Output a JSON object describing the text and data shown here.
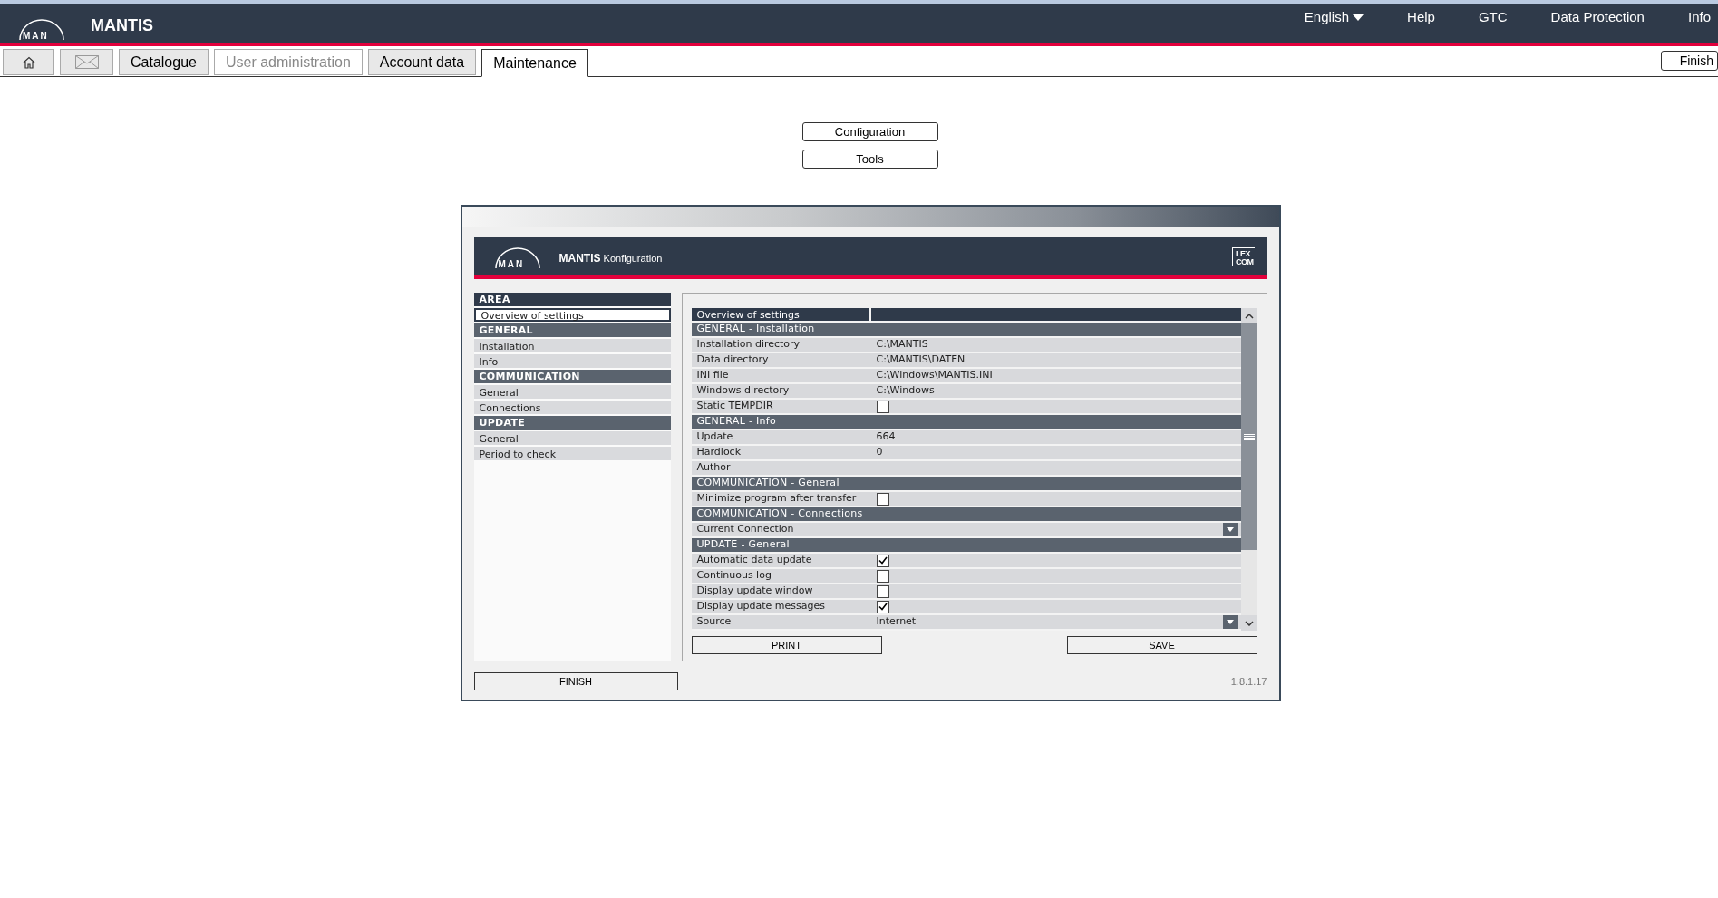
{
  "header": {
    "logo_text": "MAN",
    "title": "MANTIS",
    "menu": [
      {
        "label": "English",
        "dropdown": true
      },
      {
        "label": "Help",
        "dropdown": false
      },
      {
        "label": "GTC",
        "dropdown": false
      },
      {
        "label": "Data Protection",
        "dropdown": false
      },
      {
        "label": "Info",
        "dropdown": false
      }
    ]
  },
  "tabs": [
    {
      "kind": "home",
      "selected": false,
      "disabled": false
    },
    {
      "kind": "mail",
      "selected": false,
      "disabled": false
    },
    {
      "kind": "text",
      "label": "Catalogue",
      "selected": false,
      "disabled": false
    },
    {
      "kind": "text",
      "label": "User administration",
      "selected": false,
      "disabled": true
    },
    {
      "kind": "text",
      "label": "Account data",
      "selected": false,
      "disabled": false
    },
    {
      "kind": "text",
      "label": "Maintenance",
      "selected": true,
      "disabled": false
    }
  ],
  "finish_top": "Finish",
  "maintenance_buttons": [
    "Configuration",
    "Tools"
  ],
  "dialog": {
    "logo_text": "MAN",
    "app_name": "MANTIS",
    "title": "Konfiguration",
    "brand_logo": [
      "LEX",
      "COM"
    ],
    "sidebar": [
      {
        "kind": "header",
        "label": "AREA"
      },
      {
        "kind": "item",
        "label": "Overview of settings",
        "selected": true
      },
      {
        "kind": "header",
        "label": "GENERAL"
      },
      {
        "kind": "item",
        "label": "Installation",
        "selected": false
      },
      {
        "kind": "item",
        "label": "Info",
        "selected": false
      },
      {
        "kind": "header",
        "label": "COMMUNICATION"
      },
      {
        "kind": "item",
        "label": "General",
        "selected": false
      },
      {
        "kind": "item",
        "label": "Connections",
        "selected": false
      },
      {
        "kind": "header",
        "label": "UPDATE"
      },
      {
        "kind": "item",
        "label": "General",
        "selected": false
      },
      {
        "kind": "item",
        "label": "Period to check",
        "selected": false
      }
    ],
    "table_title": "Overview of settings",
    "rows": [
      {
        "kind": "section",
        "label": "GENERAL - Installation"
      },
      {
        "kind": "text",
        "label": "Installation directory",
        "value": "C:\\MANTIS"
      },
      {
        "kind": "text",
        "label": "Data directory",
        "value": "C:\\MANTIS\\DATEN"
      },
      {
        "kind": "text",
        "label": "INI file",
        "value": "C:\\Windows\\MANTIS.INI"
      },
      {
        "kind": "text",
        "label": "Windows directory",
        "value": "C:\\Windows"
      },
      {
        "kind": "checkbox",
        "label": "Static TEMPDIR",
        "checked": false
      },
      {
        "kind": "section",
        "label": "GENERAL - Info"
      },
      {
        "kind": "text",
        "label": "Update",
        "value": "664"
      },
      {
        "kind": "text",
        "label": "Hardlock",
        "value": "0"
      },
      {
        "kind": "text",
        "label": "Author"
      },
      {
        "kind": "section",
        "label": "COMMUNICATION - General"
      },
      {
        "kind": "checkbox",
        "label": "Minimize program after transfer",
        "checked": false
      },
      {
        "kind": "section",
        "label": "COMMUNICATION - Connections"
      },
      {
        "kind": "dropdown",
        "label": "Current Connection"
      },
      {
        "kind": "section",
        "label": "UPDATE - General"
      },
      {
        "kind": "checkbox",
        "label": "Automatic data update",
        "checked": true
      },
      {
        "kind": "checkbox",
        "label": "Continuous log",
        "checked": false
      },
      {
        "kind": "checkbox",
        "label": "Display update window",
        "checked": false
      },
      {
        "kind": "checkbox",
        "label": "Display update messages",
        "checked": true
      },
      {
        "kind": "dropdown",
        "label": "Source",
        "value": "Internet"
      }
    ],
    "print_button": "PRINT",
    "save_button": "SAVE",
    "finish_button": "FINISH",
    "version": "1.8.1.17"
  }
}
